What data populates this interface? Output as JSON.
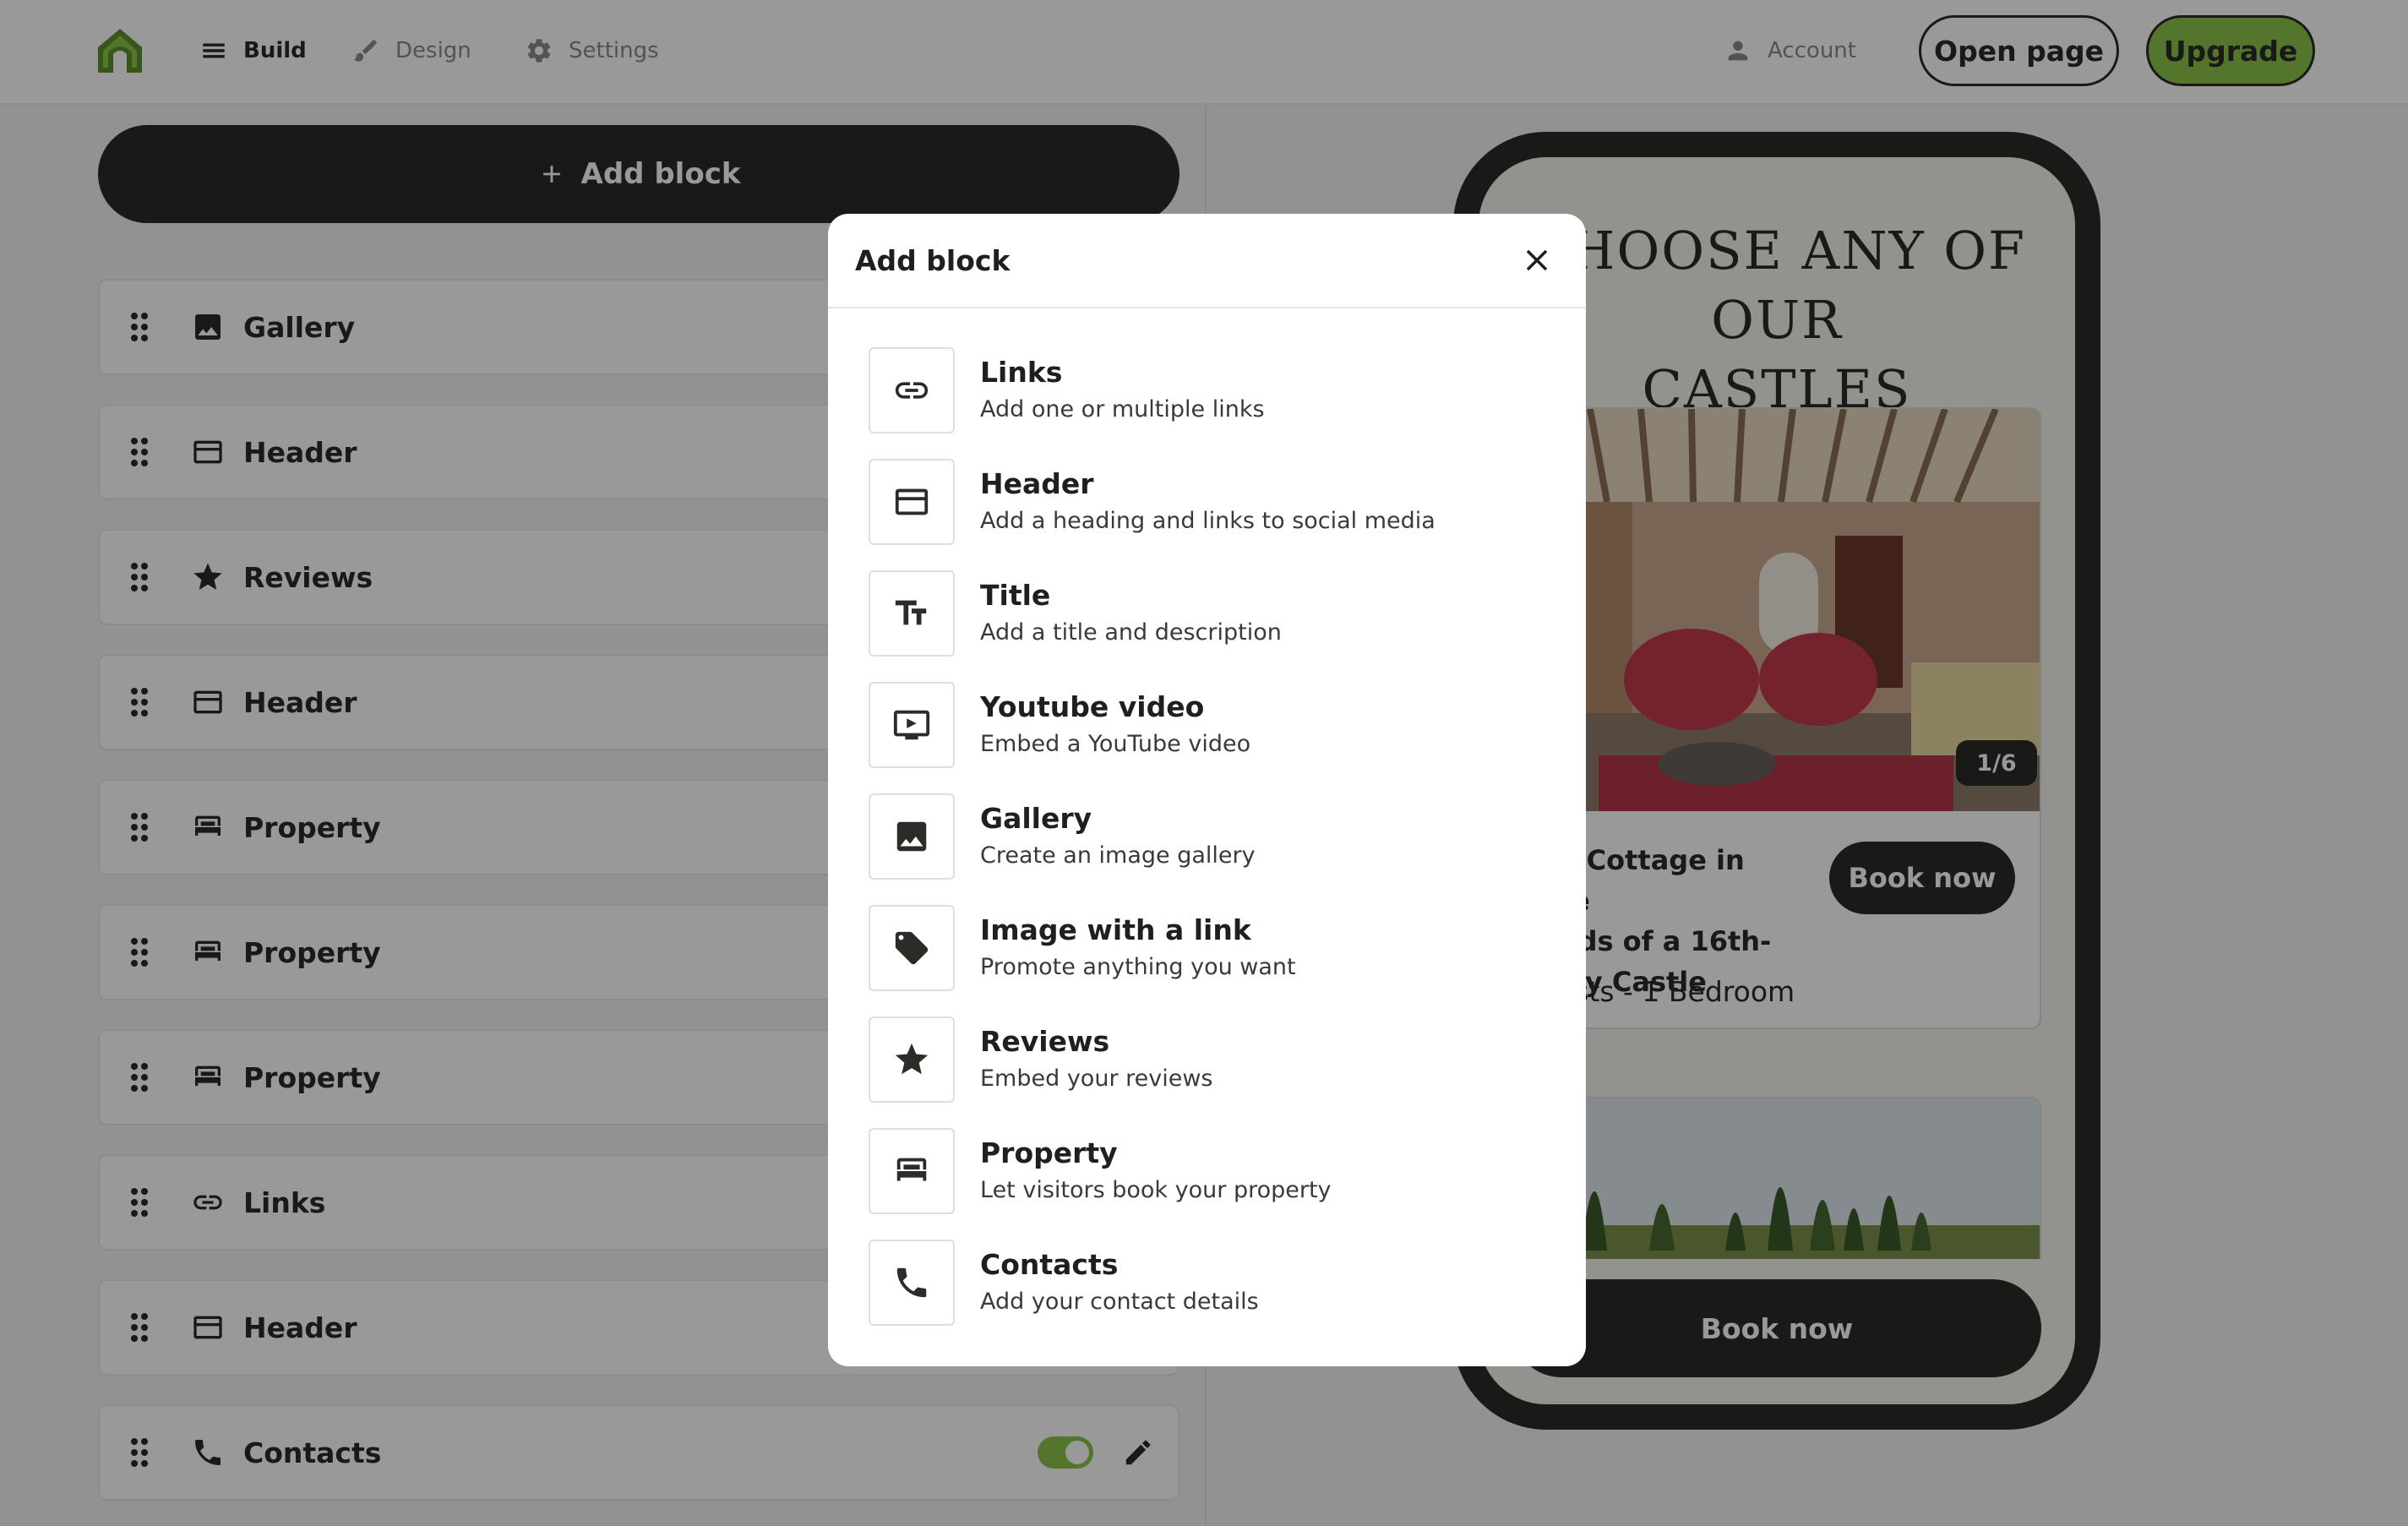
{
  "topbar": {
    "nav": [
      {
        "label": "Build",
        "icon": "hamburger-icon"
      },
      {
        "label": "Design",
        "icon": "brush-icon"
      },
      {
        "label": "Settings",
        "icon": "gear-icon"
      }
    ],
    "account_label": "Account",
    "open_page_label": "Open page",
    "upgrade_label": "Upgrade"
  },
  "left": {
    "add_block_label": "Add block",
    "blocks": [
      {
        "label": "Gallery",
        "icon": "image-icon"
      },
      {
        "label": "Header",
        "icon": "header-icon"
      },
      {
        "label": "Reviews",
        "icon": "star-icon"
      },
      {
        "label": "Header",
        "icon": "header-icon"
      },
      {
        "label": "Property",
        "icon": "bed-icon"
      },
      {
        "label": "Property",
        "icon": "bed-icon"
      },
      {
        "label": "Property",
        "icon": "bed-icon"
      },
      {
        "label": "Links",
        "icon": "link-icon"
      },
      {
        "label": "Header",
        "icon": "header-icon"
      },
      {
        "label": "Contacts",
        "icon": "phone-icon",
        "enabled": true
      }
    ]
  },
  "preview": {
    "title_line1": "CHOOSE ANY OF OUR",
    "title_line2": "CASTLES",
    "gallery_counter": "1/6",
    "card_title_lines": [
      "he Cottage in the",
      "unds of a 16th-",
      "tury Castle"
    ],
    "card_subtitle": "uests - 1 Bedroom",
    "book_small_label": "Book now",
    "book_big_label": "Book now"
  },
  "modal": {
    "title": "Add block",
    "options": [
      {
        "name": "Links",
        "desc": "Add one or multiple links",
        "icon": "link-icon"
      },
      {
        "name": "Header",
        "desc": "Add a heading and links to social media",
        "icon": "header-icon"
      },
      {
        "name": "Title",
        "desc": "Add a title and description",
        "icon": "text-size-icon"
      },
      {
        "name": "Youtube video",
        "desc": "Embed a YouTube video",
        "icon": "video-icon"
      },
      {
        "name": "Gallery",
        "desc": "Create an image gallery",
        "icon": "image-icon"
      },
      {
        "name": "Image with a link",
        "desc": "Promote anything you want",
        "icon": "tag-icon"
      },
      {
        "name": "Reviews",
        "desc": "Embed your reviews",
        "icon": "star-icon"
      },
      {
        "name": "Property",
        "desc": "Let visitors book your property",
        "icon": "bed-icon"
      },
      {
        "name": "Contacts",
        "desc": "Add your contact details",
        "icon": "phone-icon"
      }
    ]
  },
  "colors": {
    "dark": "#2b2b28",
    "accent_green": "#8bc34a",
    "overlay": "rgba(0,0,0,0.4)"
  }
}
